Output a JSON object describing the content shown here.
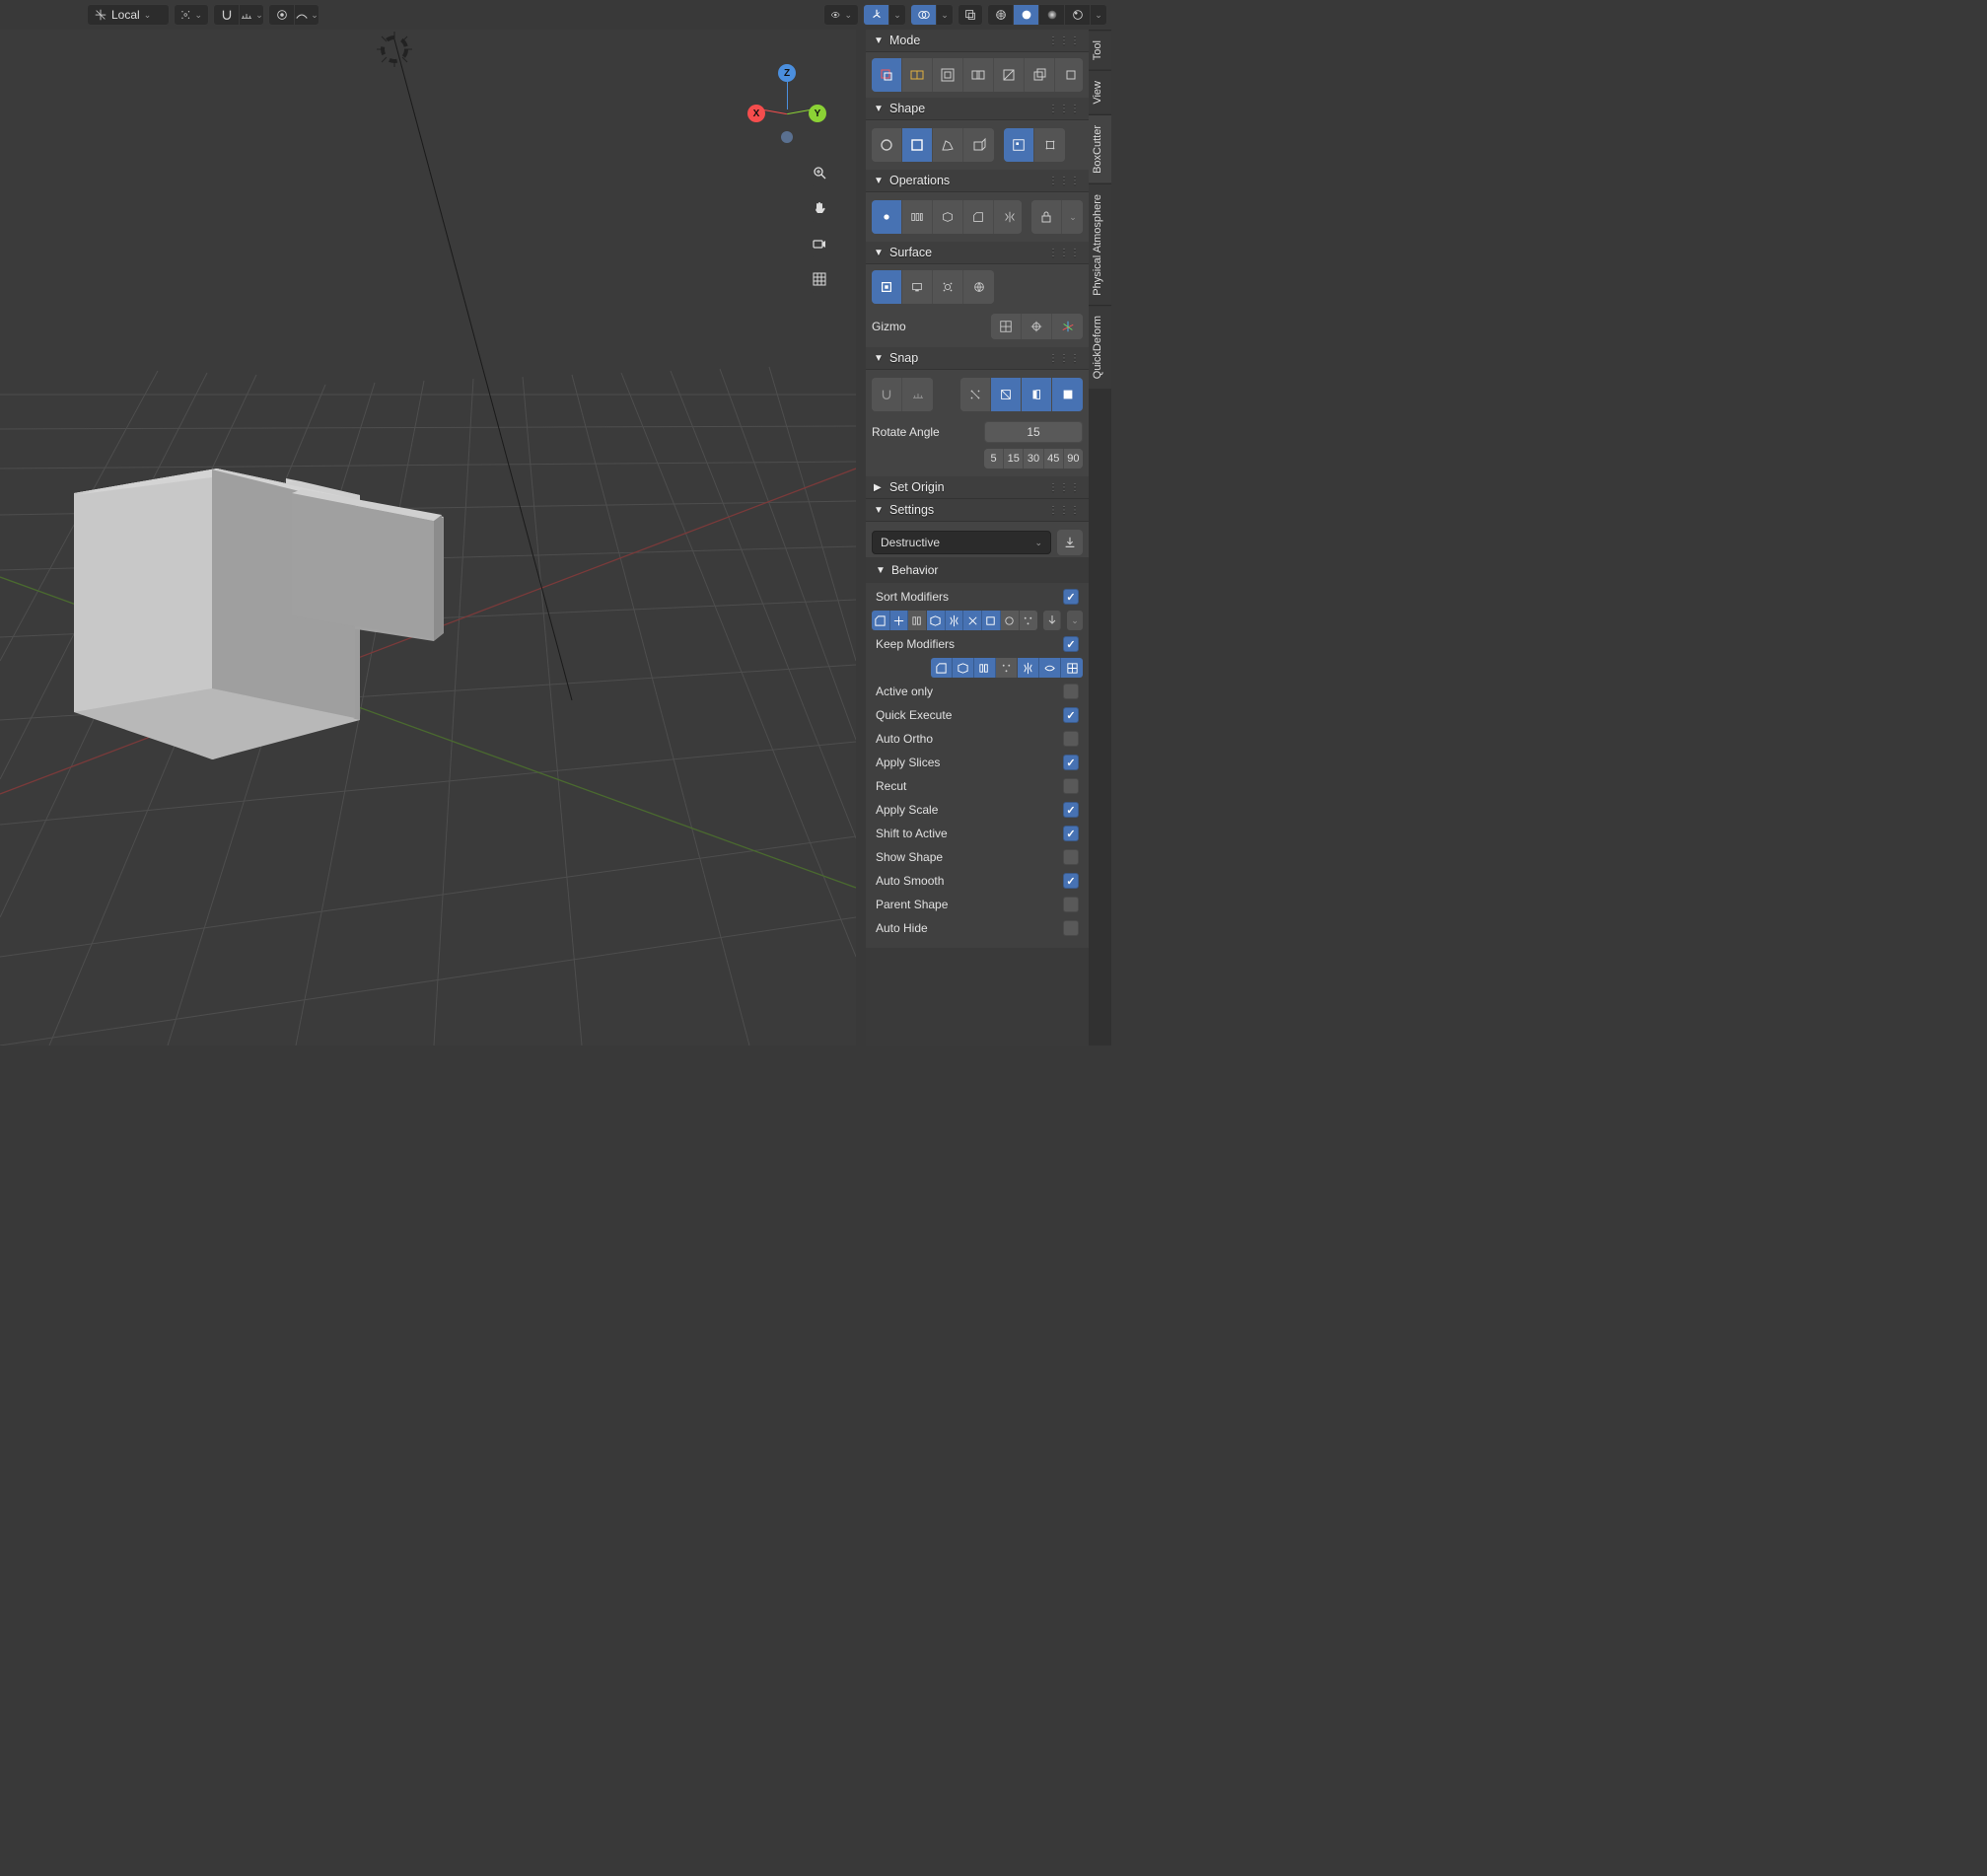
{
  "header": {
    "orientation": "Local",
    "orientation_icon": "orientation-icon",
    "pivot_icon": "pivot-icon",
    "snap_icon": "snap-icon",
    "proportional_icon": "proportional-icon",
    "curve_icon": "curve-icon"
  },
  "axis": {
    "z": "Z",
    "x": "X",
    "y": "Y"
  },
  "panel": {
    "mode": {
      "title": "Mode"
    },
    "shape": {
      "title": "Shape"
    },
    "operations": {
      "title": "Operations"
    },
    "surface": {
      "title": "Surface",
      "gizmo_label": "Gizmo"
    },
    "snap": {
      "title": "Snap",
      "rotate_label": "Rotate Angle",
      "rotate_value": "15",
      "presets": [
        "5",
        "15",
        "30",
        "45",
        "90"
      ]
    },
    "set_origin": {
      "title": "Set Origin"
    },
    "settings": {
      "title": "Settings",
      "method": "Destructive",
      "behavior_title": "Behavior",
      "sort_modifiers": "Sort Modifiers",
      "keep_modifiers": "Keep Modifiers",
      "options": [
        {
          "label": "Active only",
          "checked": false
        },
        {
          "label": "Quick Execute",
          "checked": true
        },
        {
          "label": "Auto Ortho",
          "checked": false
        },
        {
          "label": "Apply Slices",
          "checked": true
        },
        {
          "label": "Recut",
          "checked": false
        },
        {
          "label": "Apply Scale",
          "checked": true
        },
        {
          "label": "Shift to Active",
          "checked": true
        },
        {
          "label": "Show Shape",
          "checked": false
        },
        {
          "label": "Auto Smooth",
          "checked": true
        },
        {
          "label": "Parent Shape",
          "checked": false
        },
        {
          "label": "Auto Hide",
          "checked": false
        }
      ]
    }
  },
  "vtabs": [
    "Tool",
    "View",
    "BoxCutter",
    "Physical Atmosphere",
    "QuickDeform"
  ]
}
